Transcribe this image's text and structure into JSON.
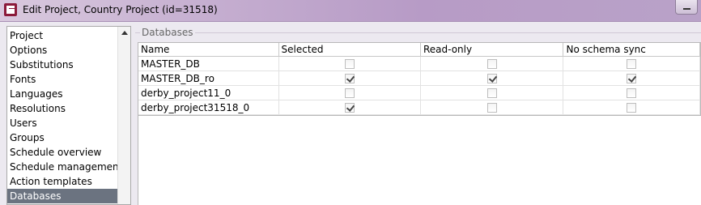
{
  "window": {
    "title": "Edit Project, Country Project (id=31518)"
  },
  "nav": {
    "items": [
      {
        "label": "Project"
      },
      {
        "label": "Options"
      },
      {
        "label": "Substitutions"
      },
      {
        "label": "Fonts"
      },
      {
        "label": "Languages"
      },
      {
        "label": "Resolutions"
      },
      {
        "label": "Users"
      },
      {
        "label": "Groups"
      },
      {
        "label": "Schedule overview"
      },
      {
        "label": "Schedule management"
      },
      {
        "label": "Action templates"
      },
      {
        "label": "Databases"
      }
    ],
    "selected": "Databases"
  },
  "databases": {
    "group_label": "Databases",
    "columns": [
      "Name",
      "Selected",
      "Read-only",
      "No schema sync"
    ],
    "rows": [
      {
        "name": "MASTER_DB",
        "selected": false,
        "read_only": false,
        "no_schema_sync": false
      },
      {
        "name": "MASTER_DB_ro",
        "selected": true,
        "read_only": true,
        "no_schema_sync": true
      },
      {
        "name": "derby_project11_0",
        "selected": false,
        "read_only": false,
        "no_schema_sync": false
      },
      {
        "name": "derby_project31518_0",
        "selected": true,
        "read_only": false,
        "no_schema_sync": false
      }
    ]
  }
}
